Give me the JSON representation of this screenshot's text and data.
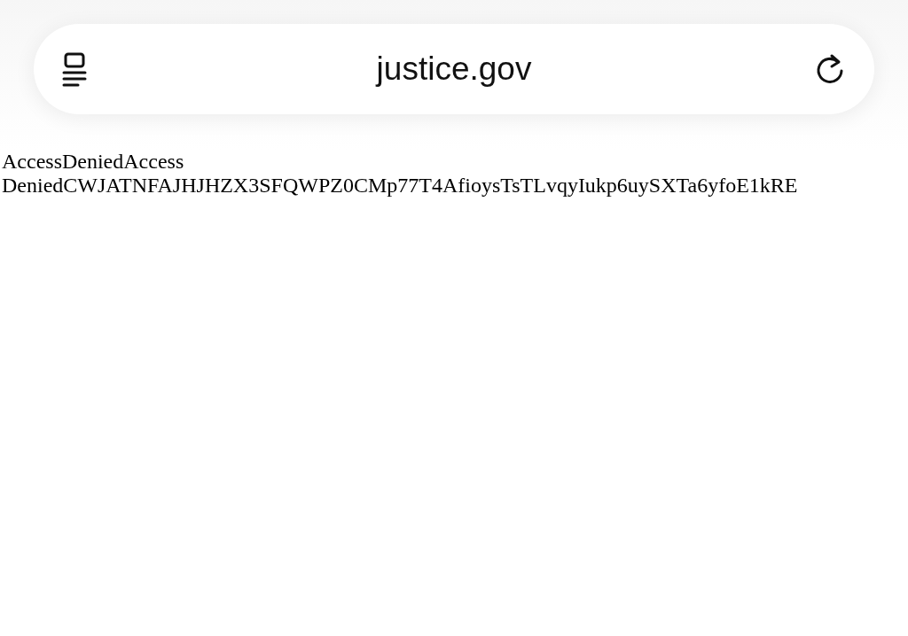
{
  "address_bar": {
    "url": "justice.gov"
  },
  "page": {
    "text": "AccessDeniedAccess DeniedCWJATNFAJHJHZX3SFQWPZ0CMp77T4AfioysTsTLvqyIukp6uySXTa6yfoE1kRE"
  }
}
